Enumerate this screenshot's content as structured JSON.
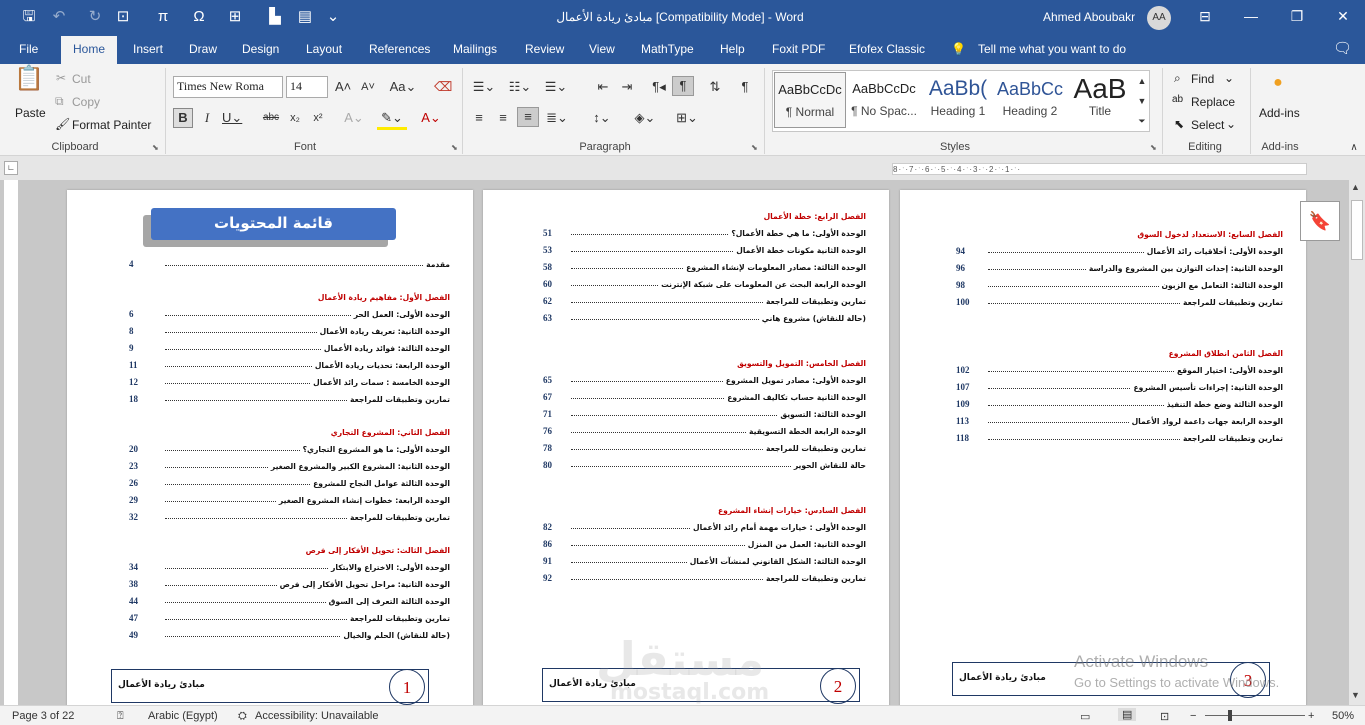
{
  "titlebar": {
    "title": "مبادئ ريادة الأعمال [Compatibility Mode] - Word",
    "user": "Ahmed Aboubakr",
    "initials": "AA"
  },
  "qat": {
    "save": "🖫",
    "undo": "↶",
    "redo": "↻",
    "pi": "π",
    "omega": "Ω",
    "more": "⌄"
  },
  "tabs": [
    "File",
    "Home",
    "Insert",
    "Draw",
    "Design",
    "Layout",
    "References",
    "Mailings",
    "Review",
    "View",
    "MathType",
    "Help",
    "Foxit PDF",
    "Efofex Classic"
  ],
  "tellme": "Tell me what you want to do",
  "clipboard": {
    "paste": "Paste",
    "cut": "Cut",
    "copy": "Copy",
    "format_painter": "Format Painter",
    "label": "Clipboard"
  },
  "font": {
    "name": "Times New Roma",
    "size": "14",
    "label": "Font"
  },
  "paragraph": {
    "label": "Paragraph"
  },
  "styles": {
    "label": "Styles",
    "items": [
      {
        "preview": "AaBbCcDc",
        "name": "¶ Normal"
      },
      {
        "preview": "AaBbCcDc",
        "name": "¶ No Spac..."
      },
      {
        "preview": "AaBb(",
        "name": "Heading 1"
      },
      {
        "preview": "AaBbCc",
        "name": "Heading 2"
      },
      {
        "preview": "AaB",
        "name": "Title"
      }
    ]
  },
  "editing": {
    "find": "Find",
    "replace": "Replace",
    "select": "Select",
    "label": "Editing"
  },
  "addins": {
    "button": "Add-ins",
    "label": "Add-ins"
  },
  "ruler": {
    "text": "8·ˑ·7·ˑ·6·ˑ·5·ˑ·4·ˑ·3·ˑ·2·ˑ·1·ˑ·"
  },
  "page1": {
    "banner": "قائمة المحتويات",
    "rows": [
      {
        "kind": "entry",
        "text": "مقدمة",
        "num": "4"
      },
      {
        "kind": "chap",
        "text": "الفصل الأول: مفاهيم ريادة الأعمال"
      },
      {
        "kind": "entry",
        "text": "الوحدة الأولى: العمل الحر",
        "num": "6"
      },
      {
        "kind": "entry",
        "text": "الوحدة الثانية: تعريف ريادة الأعمال",
        "num": "8"
      },
      {
        "kind": "entry",
        "text": "الوحدة الثالثة: فوائد ريادة الأعمال",
        "num": "9"
      },
      {
        "kind": "entry",
        "text": "الوحدة الرابعة: تحديات ريادة الأعمال",
        "num": "11"
      },
      {
        "kind": "entry",
        "text": "الوحدة الخامسة : سمات رائد الأعمال",
        "num": "12"
      },
      {
        "kind": "entry",
        "text": "تمارين وتطبيقات للمراجعة",
        "num": "18"
      },
      {
        "kind": "chap",
        "text": "الفصل الثاني: المشروع التجاري"
      },
      {
        "kind": "entry",
        "text": "الوحدة الأولى: ما هو المشروع التجاري؟",
        "num": "20"
      },
      {
        "kind": "entry",
        "text": "الوحدة الثانية: المشروع الكبير والمشروع الصغير",
        "num": "23"
      },
      {
        "kind": "entry",
        "text": "الوحدة الثالثة عوامل النجاح للمشروع",
        "num": "26"
      },
      {
        "kind": "entry",
        "text": "الوحدة الرابعة: خطوات إنشاء المشروع الصغير",
        "num": "29"
      },
      {
        "kind": "entry",
        "text": "تمارين وتطبيقات للمراجعة",
        "num": "32"
      },
      {
        "kind": "chap",
        "text": "الفصل الثالث: تحويل الأفكار إلى فرص"
      },
      {
        "kind": "entry",
        "text": "الوحدة الأولى: الاختراع والابتكار",
        "num": "34"
      },
      {
        "kind": "entry",
        "text": "الوحدة الثانية: مراحل تحويل الأفكار إلى فرص",
        "num": "38"
      },
      {
        "kind": "entry",
        "text": "الوحدة الثالثة التعرف إلى السوق",
        "num": "44"
      },
      {
        "kind": "entry",
        "text": "تمارين وتطبيقات للمراجعة",
        "num": "47"
      },
      {
        "kind": "entry",
        "text": "(حالة للنقاش) الحلم والخيال",
        "num": "49"
      }
    ],
    "footer": "مبادئ ريادة الأعمال",
    "page_no": "1"
  },
  "page2": {
    "rows": [
      {
        "kind": "chap",
        "text": "الفصل الرابع: خطة الأعمال"
      },
      {
        "kind": "entry",
        "text": "الوحدة الأولى: ما هي خطة الأعمال؟",
        "num": "51"
      },
      {
        "kind": "entry",
        "text": "الوحدة الثانية مكونات خطة الأعمال",
        "num": "53"
      },
      {
        "kind": "entry",
        "text": "الوحدة الثالثة: مصادر المعلومات لإنشاء المشروع",
        "num": "58"
      },
      {
        "kind": "entry",
        "text": "الوحدة الرابعة البحث عن المعلومات على شبكة الإنترنت",
        "num": "60"
      },
      {
        "kind": "entry",
        "text": "تمارين وتطبيقات للمراجعة",
        "num": "62"
      },
      {
        "kind": "entry",
        "text": "(حالة للنقاش) مشروع هاني",
        "num": "63"
      },
      {
        "kind": "chap",
        "text": "الفصل الخامس: التمويل والتسويق"
      },
      {
        "kind": "entry",
        "text": "الوحدة الأولى: مصادر تمويل المشروع",
        "num": "65"
      },
      {
        "kind": "entry",
        "text": "الوحدة الثانية حساب تكاليف المشروع",
        "num": "67"
      },
      {
        "kind": "entry",
        "text": "الوحدة الثالثة: التسويق",
        "num": "71"
      },
      {
        "kind": "entry",
        "text": "الوحدة الرابعة الخطة التسويقية",
        "num": "76"
      },
      {
        "kind": "entry",
        "text": "تمارين وتطبيقات للمراجعة",
        "num": "78"
      },
      {
        "kind": "entry",
        "text": "حالة للنقاش الحوير",
        "num": "80"
      },
      {
        "kind": "chap",
        "text": "الفصل السادس: خيارات إنشاء المشروع"
      },
      {
        "kind": "entry",
        "text": "الوحدة الأولى : خيارات مهمة أمام رائد الأعمال",
        "num": "82"
      },
      {
        "kind": "entry",
        "text": "الوحدة الثانية: العمل من المنزل",
        "num": "86"
      },
      {
        "kind": "entry",
        "text": "الوحدة الثالثة: الشكل القانوني لمنشآت الأعمال",
        "num": "91"
      },
      {
        "kind": "entry",
        "text": "تمارين وتطبيقات للمراجعة",
        "num": "92"
      }
    ],
    "footer": "مبادئ ريادة الأعمال",
    "page_no": "2"
  },
  "page3": {
    "rows": [
      {
        "kind": "chap",
        "text": "الفصل السابع: الاستعداد لدخول السوق"
      },
      {
        "kind": "entry",
        "text": "الوحدة الأولى: أخلاقيات رائد الأعمال",
        "num": "94"
      },
      {
        "kind": "entry",
        "text": "الوحدة الثانية: إحداث التوازن بين المشروع والدراسة",
        "num": "96"
      },
      {
        "kind": "entry",
        "text": "الوحدة الثالثة: التعامل مع الزبون",
        "num": "98"
      },
      {
        "kind": "entry",
        "text": "تمارين وتطبيقات للمراجعة",
        "num": "100"
      },
      {
        "kind": "chap",
        "text": "الفصل الثامن انطلاق المشروع"
      },
      {
        "kind": "entry",
        "text": "الوحدة الأولى: اختيار الموقع",
        "num": "102"
      },
      {
        "kind": "entry",
        "text": "الوحدة الثانية: إجراءات تأسيس المشروع",
        "num": "107"
      },
      {
        "kind": "entry",
        "text": "الوحدة الثالثة وضع خطة التنفيذ",
        "num": "109"
      },
      {
        "kind": "entry",
        "text": "الوحدة الرابعة جهات داعمة لرواد الأعمال",
        "num": "113"
      },
      {
        "kind": "entry",
        "text": "تمارين وتطبيقات للمراجعة",
        "num": "118"
      }
    ],
    "footer": "مبادئ ريادة الأعمال",
    "page_no": "3"
  },
  "status": {
    "page": "Page 3 of 22",
    "language": "Arabic (Egypt)",
    "accessibility": "Accessibility: Unavailable",
    "zoom": "50%"
  },
  "watermark": {
    "line1": "Activate Windows",
    "line2": "Go to Settings to activate Windows."
  },
  "logo": {
    "arabic": "مستقل",
    "latin": "mostaql.com"
  }
}
